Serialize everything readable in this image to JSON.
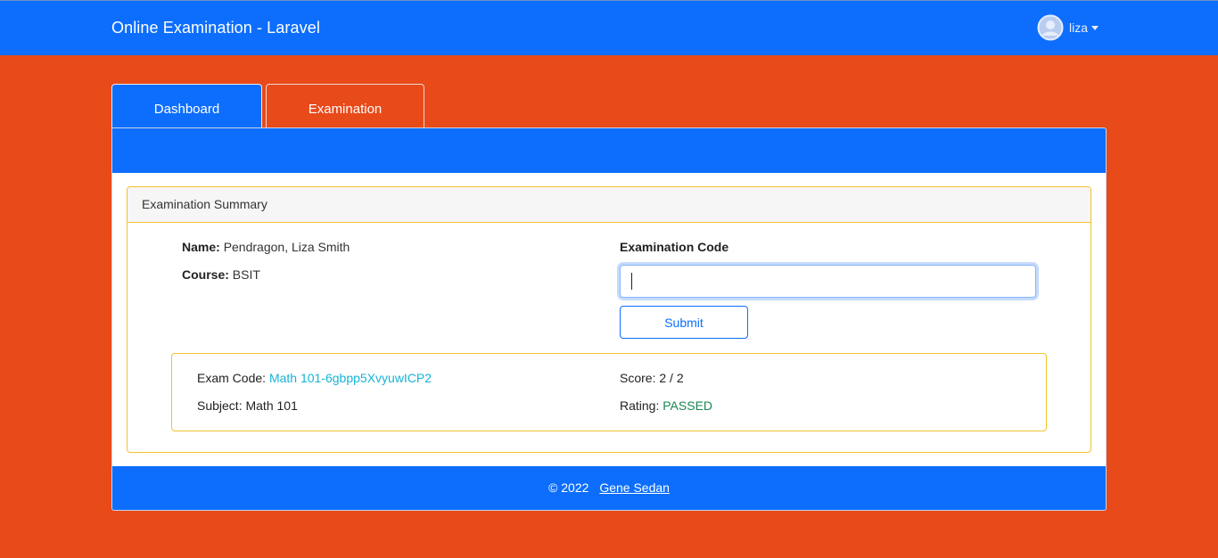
{
  "navbar": {
    "brand": "Online Examination - Laravel",
    "user": "liza"
  },
  "tabs": [
    {
      "label": "Dashboard",
      "active": true
    },
    {
      "label": "Examination",
      "active": false
    }
  ],
  "summary": {
    "title": "Examination Summary",
    "name_label": "Name:",
    "name_value": "Pendragon, Liza Smith",
    "course_label": "Course:",
    "course_value": "BSIT",
    "code_label": "Examination Code",
    "code_value": "",
    "code_placeholder": "",
    "submit_label": "Submit"
  },
  "result": {
    "exam_code_label": "Exam Code:",
    "exam_code_value": "Math 101-6gbpp5XvyuwICP2",
    "subject_label": "Subject:",
    "subject_value": "Math 101",
    "score_label": "Score:",
    "score_value": "2 / 2",
    "rating_label": "Rating:",
    "rating_value": "PASSED"
  },
  "footer": {
    "copyright": "© 2022",
    "author": "Gene Sedan"
  },
  "colors": {
    "primary": "#0d6efd",
    "background": "#e84a1a",
    "warning_border": "#f0c330",
    "link": "#17b3d6",
    "success": "#198754"
  }
}
